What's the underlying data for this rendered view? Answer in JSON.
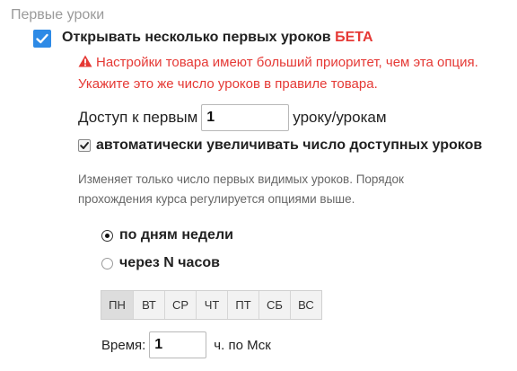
{
  "section": {
    "title": "Первые уроки"
  },
  "main_option": {
    "label": "Открывать несколько первых уроков",
    "badge": "БЕТА",
    "checked": true
  },
  "warning": {
    "icon": "warning-triangle-icon",
    "text": "Настройки товара имеют больший приоритет, чем эта опция. Укажите это же число уроков в правиле товара."
  },
  "access": {
    "prefix": "Доступ к первым",
    "value": "1",
    "suffix": "уроку/урокам"
  },
  "auto_increase": {
    "label": "автоматически увеличивать число доступных уроков",
    "checked": true
  },
  "hint": {
    "text": "Изменяет только число первых видимых уроков. Порядок прохождения курса регулируется опциями выше."
  },
  "schedule": {
    "by_days_label": "по дням недели",
    "by_hours_label": "через N часов",
    "selected": "by_days"
  },
  "days": [
    "ПН",
    "ВТ",
    "СР",
    "ЧТ",
    "ПТ",
    "СБ",
    "ВС"
  ],
  "time": {
    "label": "Время:",
    "value": "1",
    "suffix": "ч. по Мск"
  },
  "colors": {
    "accent": "#2d8ae6",
    "warning": "#e53935",
    "hint": "#666666"
  }
}
